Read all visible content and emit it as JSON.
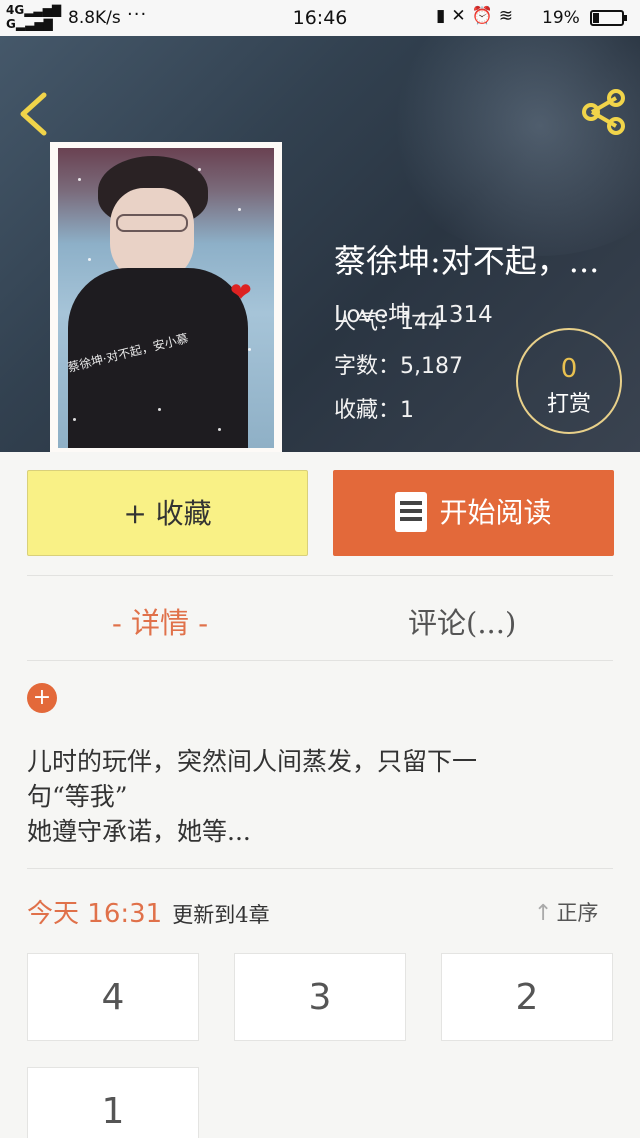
{
  "status_bar": {
    "network_top": "4G",
    "network_bottom": "G",
    "speed": "8.8K/s",
    "more": "···",
    "time": "16:46",
    "battery": "19%"
  },
  "header": {
    "back_icon": "chevron-left-icon",
    "share_icon": "share-icon",
    "cover_caption": "蔡徐坤·对不起，安小慕",
    "title": "蔡徐坤:对不起，...",
    "author": "Love坤—1314",
    "popularity_label": "人气：",
    "popularity_value": "144",
    "words_label": "字数：",
    "words_value": "5,187",
    "favorites_label": "收藏：",
    "favorites_value": "1",
    "tip_count": "0",
    "tip_label": "打赏"
  },
  "actions": {
    "favorite_label": "+ 收藏",
    "read_label": "开始阅读"
  },
  "tabs": {
    "detail": "- 详情 -",
    "comments": "评论(...)"
  },
  "description": {
    "expand": "+",
    "line1": "儿时的玩伴，突然间人间蒸发，只留下一",
    "line2": "句“等我”",
    "line3": "她遵守承诺，她等..."
  },
  "update": {
    "today": "今天",
    "time": "16:31",
    "info": "更新到4章",
    "sort_label": "正序"
  },
  "chapters": [
    "4",
    "3",
    "2",
    "1"
  ],
  "colors": {
    "accent": "#e3693a",
    "favorite_button": "#f9f186",
    "tip_number": "#e8c050"
  }
}
